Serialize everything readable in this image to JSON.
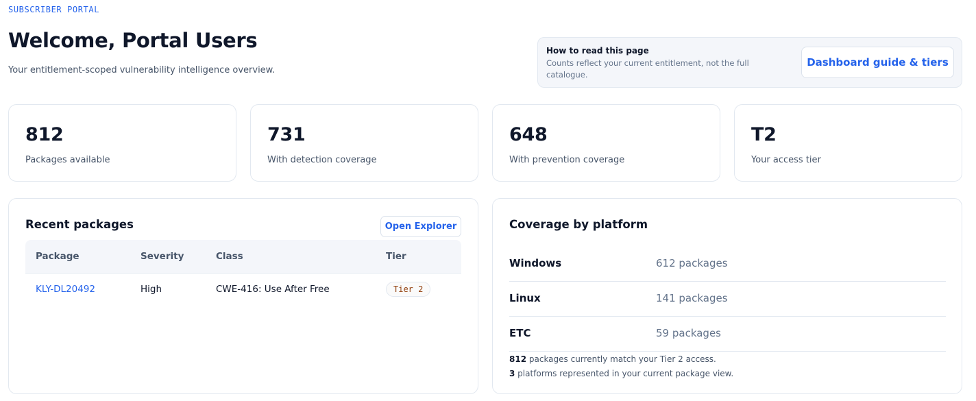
{
  "header": {
    "eyebrow": "SUBSCRIBER PORTAL",
    "title": "Welcome, Portal Users",
    "subtitle": "Your entitlement-scoped vulnerability intelligence overview."
  },
  "help": {
    "title": "How to read this page",
    "body": "Counts reflect your current entitlement, not the full catalogue.",
    "button_label": "Dashboard guide & tiers"
  },
  "stats": [
    {
      "value": "812",
      "label": "Packages available"
    },
    {
      "value": "731",
      "label": "With detection coverage"
    },
    {
      "value": "648",
      "label": "With prevention coverage"
    },
    {
      "value": "T2",
      "label": "Your access tier"
    }
  ],
  "recent": {
    "title": "Recent packages",
    "open_label": "Open Explorer",
    "columns": [
      "Package",
      "Severity",
      "Class",
      "Tier"
    ],
    "rows": [
      {
        "package": "KLY-DL20492",
        "severity": "High",
        "class": "CWE-416: Use After Free",
        "tier": "Tier 2"
      }
    ]
  },
  "coverage": {
    "title": "Coverage by platform",
    "platforms": [
      {
        "name": "Windows",
        "count": "612 packages"
      },
      {
        "name": "Linux",
        "count": "141 packages"
      },
      {
        "name": "ETC",
        "count": "59 packages"
      }
    ],
    "note1_count": "812",
    "note1_text": " packages currently match your Tier 2 access.",
    "note2_count": "3",
    "note2_text": " platforms represented in your current package view."
  },
  "colors": {
    "accent": "#2563eb",
    "tier_text": "#92400e"
  }
}
